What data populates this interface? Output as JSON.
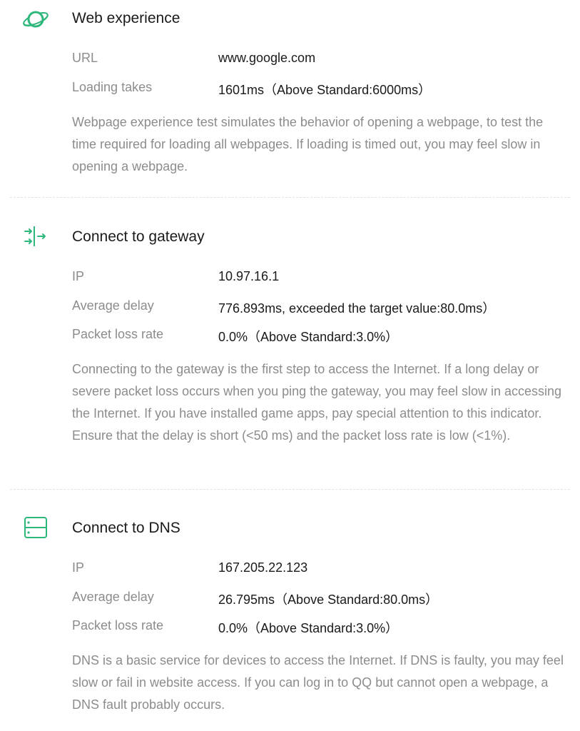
{
  "accent_color": "#2db77b",
  "web_experience": {
    "icon": "planet-icon",
    "title": "Web experience",
    "rows": [
      {
        "label": "URL",
        "value": "www.google.com"
      },
      {
        "label": "Loading takes",
        "value": "1601ms（Above Standard:6000ms）"
      }
    ],
    "description": "Webpage experience test simulates the behavior of opening a webpage, to test the time required for loading all webpages. If loading is timed out, you may feel slow in opening a webpage."
  },
  "gateway": {
    "icon": "gateway-arrows-icon",
    "title": "Connect to gateway",
    "rows": [
      {
        "label": "IP",
        "value": "10.97.16.1"
      },
      {
        "label": "Average delay",
        "value": "776.893ms, exceeded the target value:80.0ms）"
      },
      {
        "label": "Packet loss rate",
        "value": "0.0%（Above Standard:3.0%）"
      }
    ],
    "description": "Connecting to the gateway is the first step to access the Internet. If a long delay or severe packet loss occurs when you ping the gateway, you may feel slow in accessing the Internet. If you have installed game apps, pay special attention to this indicator. Ensure that the delay is short (<50 ms) and the packet loss rate is low (<1%)."
  },
  "dns": {
    "icon": "server-icon",
    "title": "Connect to DNS",
    "rows": [
      {
        "label": "IP",
        "value": "167.205.22.123"
      },
      {
        "label": "Average delay",
        "value": "26.795ms（Above Standard:80.0ms）"
      },
      {
        "label": "Packet loss rate",
        "value": "0.0%（Above Standard:3.0%）"
      }
    ],
    "description": "DNS is a basic service for devices to access the Internet. If DNS is faulty, you may feel slow or fail in website access. If you can log in to QQ but cannot open a webpage, a DNS fault probably occurs."
  }
}
